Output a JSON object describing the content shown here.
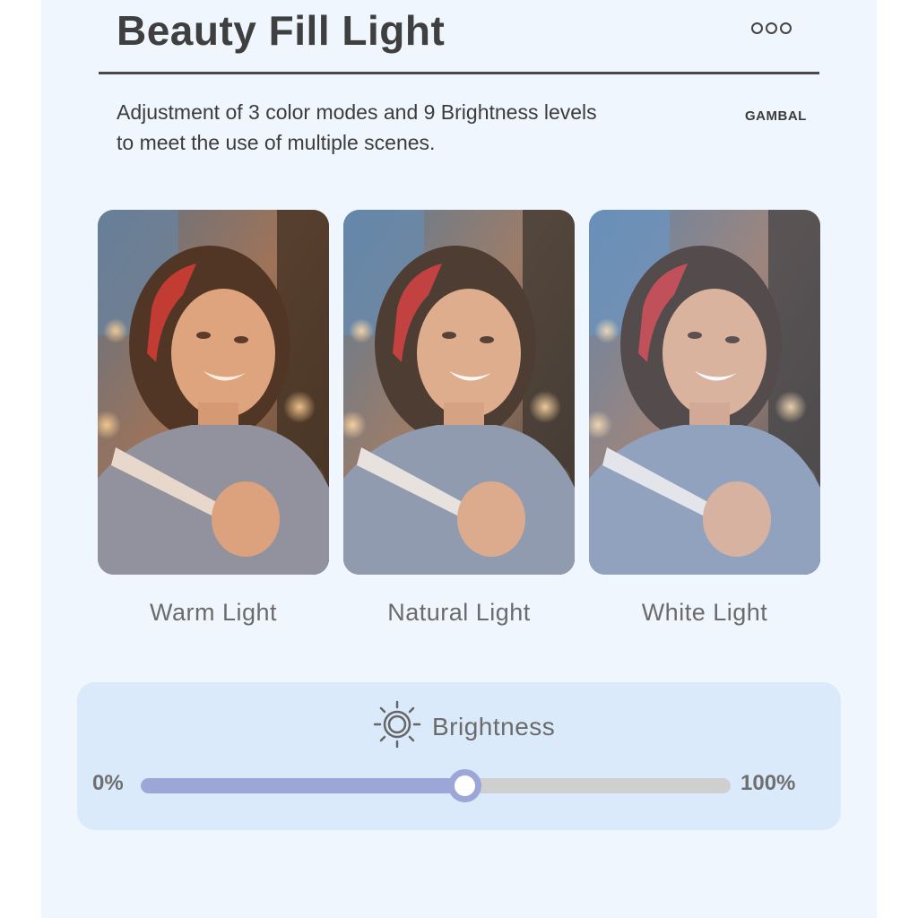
{
  "header": {
    "title": "Beauty Fill Light",
    "more_icon": "more-dots-icon"
  },
  "description": {
    "line1": "Adjustment of 3 color modes and 9 Brightness levels",
    "line2": "to meet the use of multiple scenes."
  },
  "brand": "GAMBAL",
  "modes": [
    {
      "label": "Warm Light",
      "tint": "#f2a35a"
    },
    {
      "label": "Natural Light",
      "tint": "#f7d7b8"
    },
    {
      "label": "White Light",
      "tint": "#dfe8ff"
    }
  ],
  "brightness": {
    "label": "Brightness",
    "icon": "sun-icon",
    "min_label": "0%",
    "max_label": "100%",
    "value_fraction": 0.55
  },
  "colors": {
    "accent": "#9ca7d8",
    "panel": "#dbeafb",
    "page": "#eff6fe"
  }
}
